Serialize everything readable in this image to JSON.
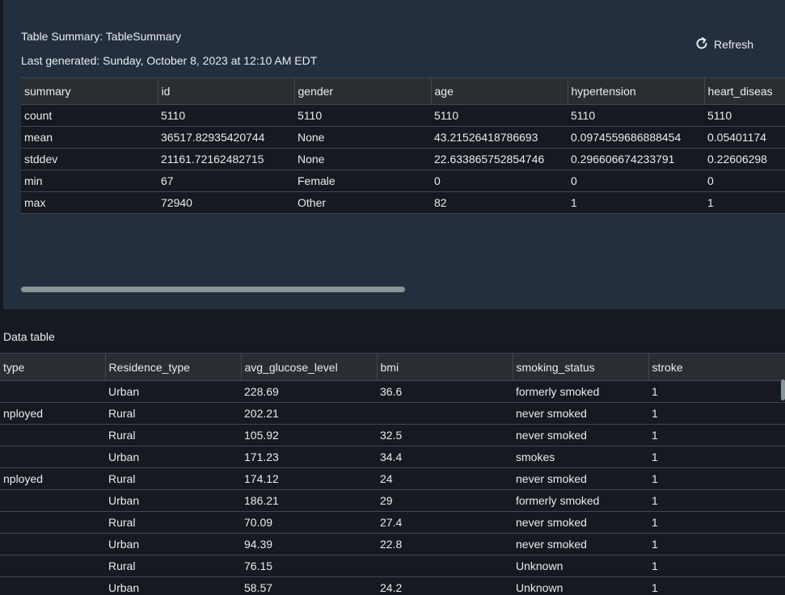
{
  "summary": {
    "title": "Table Summary: TableSummary",
    "generated": "Last generated: Sunday, October 8, 2023 at 12:10 AM EDT",
    "refresh_label": "Refresh",
    "columns": [
      "summary",
      "id",
      "gender",
      "age",
      "hypertension",
      "heart_diseas"
    ],
    "rows": [
      [
        "count",
        "5110",
        "5110",
        "5110",
        "5110",
        "5110"
      ],
      [
        "mean",
        "36517.82935420744",
        "None",
        "43.21526418786693",
        "0.0974559686888454",
        "0.05401174"
      ],
      [
        "stddev",
        "21161.72162482715",
        "None",
        "22.633865752854746",
        "0.296606674233791",
        "0.22606298"
      ],
      [
        "min",
        "67",
        "Female",
        "0",
        "0",
        "0"
      ],
      [
        "max",
        "72940",
        "Other",
        "82",
        "1",
        "1"
      ]
    ]
  },
  "data_table": {
    "label": "Data table",
    "columns": [
      "type",
      "Residence_type",
      "avg_glucose_level",
      "bmi",
      "smoking_status",
      "stroke"
    ],
    "rows": [
      [
        "",
        "Urban",
        "228.69",
        "36.6",
        "formerly smoked",
        "1"
      ],
      [
        "nployed",
        "Rural",
        "202.21",
        "",
        "never smoked",
        "1"
      ],
      [
        "",
        "Rural",
        "105.92",
        "32.5",
        "never smoked",
        "1"
      ],
      [
        "",
        "Urban",
        "171.23",
        "34.4",
        "smokes",
        "1"
      ],
      [
        "nployed",
        "Rural",
        "174.12",
        "24",
        "never smoked",
        "1"
      ],
      [
        "",
        "Urban",
        "186.21",
        "29",
        "formerly smoked",
        "1"
      ],
      [
        "",
        "Rural",
        "70.09",
        "27.4",
        "never smoked",
        "1"
      ],
      [
        "",
        "Urban",
        "94.39",
        "22.8",
        "never smoked",
        "1"
      ],
      [
        "",
        "Rural",
        "76.15",
        "",
        "Unknown",
        "1"
      ],
      [
        "",
        "Urban",
        "58.57",
        "24.2",
        "Unknown",
        "1"
      ]
    ]
  }
}
